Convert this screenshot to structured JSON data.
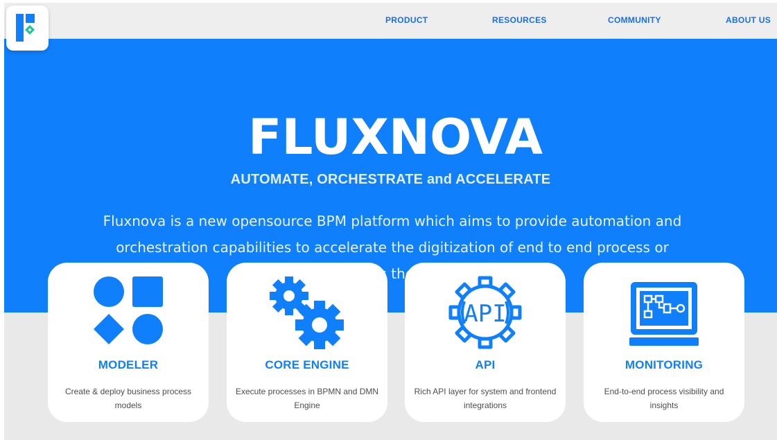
{
  "nav": {
    "logo_icon": "fluxnova-logo-icon",
    "links": [
      "PRODUCT",
      "RESOURCES",
      "COMMUNITY",
      "ABOUT US"
    ]
  },
  "hero": {
    "brand": "FLUXNOVA",
    "tagline": "AUTOMATE, ORCHESTRATE and ACCELERATE",
    "description": "Fluxnova is a new opensource BPM platform which aims to provide automation and orchestration capabilities to accelerate the digitization of end to end process or workflow across the organization."
  },
  "features": [
    {
      "icon": "shapes-icon",
      "title": "MODELER",
      "description": "Create & deploy business process models"
    },
    {
      "icon": "gears-icon",
      "title": "CORE ENGINE",
      "description": "Execute processes in BPMN and DMN Engine"
    },
    {
      "icon": "api-gear-icon",
      "title": "API",
      "icon_text": "API",
      "description": "Rich API layer for system and frontend integrations"
    },
    {
      "icon": "monitor-icon",
      "title": "MONITORING",
      "description": "End-to-end process visibility and insights"
    }
  ],
  "colors": {
    "brand_blue": "#0f7ffb",
    "nav_link": "#1a6fe8",
    "logo_accent": "#22c59a",
    "page_bg": "#e9e9e9"
  }
}
